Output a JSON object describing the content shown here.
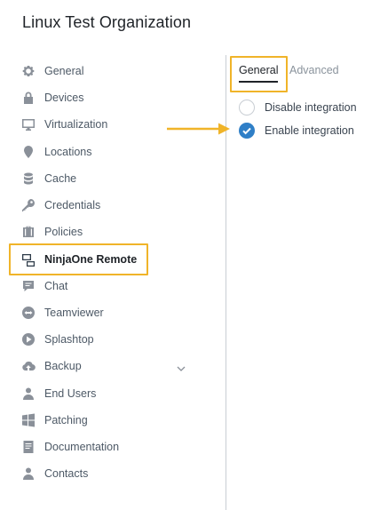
{
  "page": {
    "title": "Linux Test Organization"
  },
  "sidebar": {
    "items": [
      {
        "label": "General",
        "icon": "gear-icon"
      },
      {
        "label": "Devices",
        "icon": "lock-icon"
      },
      {
        "label": "Virtualization",
        "icon": "monitor-icon"
      },
      {
        "label": "Locations",
        "icon": "map-pin-icon"
      },
      {
        "label": "Cache",
        "icon": "database-icon"
      },
      {
        "label": "Credentials",
        "icon": "key-icon"
      },
      {
        "label": "Policies",
        "icon": "briefcase-icon"
      },
      {
        "label": "NinjaOne Remote",
        "icon": "remote-screens-icon",
        "active": true
      },
      {
        "label": "Chat",
        "icon": "chat-icon"
      },
      {
        "label": "Teamviewer",
        "icon": "teamviewer-icon"
      },
      {
        "label": "Splashtop",
        "icon": "splashtop-icon"
      },
      {
        "label": "Backup",
        "icon": "cloud-upload-icon",
        "expandable": true
      },
      {
        "label": "End Users",
        "icon": "user-icon"
      },
      {
        "label": "Patching",
        "icon": "windows-icon"
      },
      {
        "label": "Documentation",
        "icon": "document-icon"
      },
      {
        "label": "Contacts",
        "icon": "user-icon"
      }
    ]
  },
  "tabs": [
    {
      "label": "General",
      "active": true
    },
    {
      "label": "Advanced",
      "active": false
    }
  ],
  "integration": {
    "options": [
      {
        "label": "Disable integration",
        "checked": false
      },
      {
        "label": "Enable integration",
        "checked": true
      }
    ]
  },
  "colors": {
    "highlight": "#f0b429",
    "radio_checked": "#2f7fc7",
    "icon_gray": "#8a9099"
  }
}
